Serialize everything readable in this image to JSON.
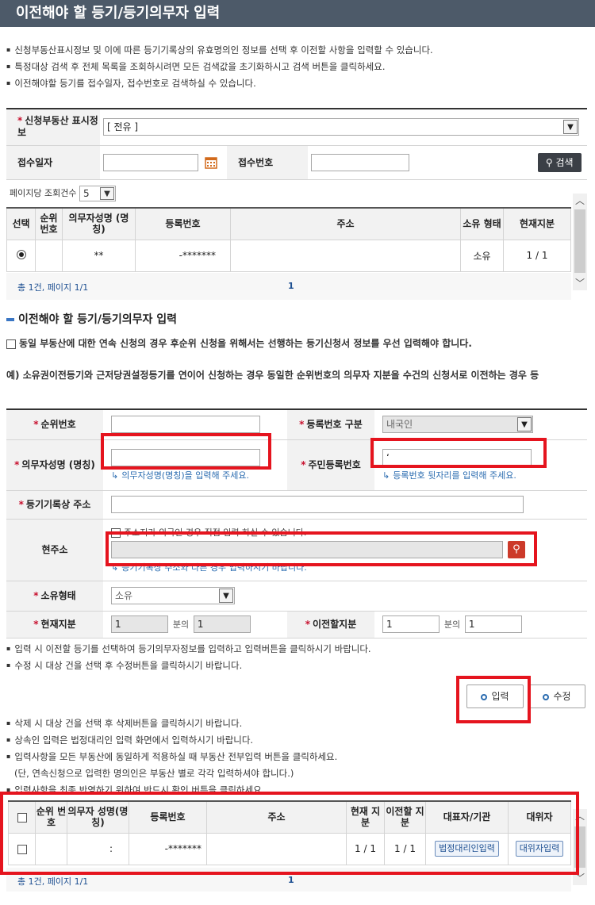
{
  "title": "이전해야 할 등기/등기의무자 입력",
  "intro_notes": [
    "신청부동산표시정보 및 이에 따른 등기기록상의 유효명의인 정보를 선택 후 이전할 사항을 입력할 수 있습니다.",
    "특정대상 검색 후 전체 목록을 조회하시려면 모든 검색값을 초기화하시고 검색 버튼을 클릭하세요.",
    "이전해야할 등기를 접수일자, 접수번호로 검색하실 수 있습니다."
  ],
  "search": {
    "property_label": "신청부동산 표시정보",
    "property_value": "[ 전유 ]",
    "receipt_date_label": "접수일자",
    "receipt_no_label": "접수번호",
    "search_button": "검색"
  },
  "per_page": {
    "label": "페이지당 조회건수",
    "value": "5"
  },
  "top_grid": {
    "headers": [
      "선택",
      "순위 번호",
      "의무자성명 (명칭)",
      "등록번호",
      "주소",
      "소유 형태",
      "현재지분"
    ],
    "rows": [
      {
        "rank": "",
        "name": "**",
        "reg_no": "-*******",
        "address": "",
        "owner_type": "소유",
        "share": "1 / 1"
      }
    ],
    "summary": "총 1건, 페이지 1/1",
    "page": "1"
  },
  "section_title": "이전해야 할 등기/등기의무자 입력",
  "section_note_1": "동일 부동산에 대한 연속 신청의 경우 후순위 신청을 위해서는 선행하는 등기신청서 정보를 우선 입력해야 합니다.",
  "section_note_2": "예) 소유권이전등기와 근저당권설정등기를 연이어 신청하는 경우 동일한 순위번호의 의무자 지분을 수건의 신청서로 이전하는 경우 등",
  "form": {
    "rank_no_label": "순위번호",
    "reg_type_label": "등록번호 구분",
    "reg_type_value": "내국인",
    "obligor_name_label": "의무자성명 (명칭)",
    "obligor_name_hint": "의무자성명(명칭)을 입력해 주세요.",
    "resident_no_label": "주민등록번호",
    "resident_no_value": "‘",
    "resident_no_hint": "등록번호 뒷자리를 입력해 주세요.",
    "record_address_label": "등기기록상 주소",
    "current_address_label": "현주소",
    "foreign_address_check": "주소지가 외국인 경우 직접 입력 하실 수 있습니다.",
    "current_address_hint": "등기기록상 주소와 다른 경우 입력하시기 바랍니다.",
    "ownership_label": "소유형태",
    "ownership_value": "소유",
    "current_share_label": "현재지분",
    "current_share_num": "1",
    "current_share_den": "1",
    "share_sep": "분의",
    "transfer_share_label": "이전할지분",
    "transfer_share_num": "1",
    "transfer_share_den": "1"
  },
  "notes_mid": [
    "입력 시 이전할 등기를 선택하여 등기의무자정보를 입력하고 입력버튼을 클릭하시기 바랍니다.",
    "수정 시 대상 건을 선택 후 수정버튼을 클릭하시기 바랍니다."
  ],
  "buttons": {
    "input": "입력",
    "modify": "수정"
  },
  "notes_low": [
    "삭제 시 대상 건을 선택 후 삭제버튼을 클릭하시기 바랍니다.",
    "상속인 입력은 법정대리인 입력 화면에서 입력하시기 바랍니다.",
    "입력사항을 모든 부동산에 동일하게 적용하실 때 부동산 전부입력 버튼을 클릭하세요.",
    "(단, 연속신청으로 입력한 명의인은 부동산 별로 각각 입력하셔야 합니다.)",
    "입력사항을 최종 반영하기 위하여 반드시 확인 버튼을 클릭하세요."
  ],
  "bottom_grid": {
    "headers": [
      "",
      "순위 번호",
      "의무자 성명(명칭)",
      "등록번호",
      "주소",
      "현재 지분",
      "이전할 지분",
      "대표자/기관",
      "대위자"
    ],
    "rows": [
      {
        "rank": "",
        "name": ":",
        "reg_no": "-*******",
        "address": "",
        "share": "1 / 1",
        "transfer": "1 / 1",
        "rep_button": "법정대리인입력",
        "subrogee_button": "대위자입력"
      }
    ],
    "summary": "총 1건, 페이지 1/1",
    "page": "1"
  },
  "accent_colors": {
    "title_bar": "#4d5a69",
    "highlight": "#e5141e",
    "link": "#1d4f91"
  }
}
